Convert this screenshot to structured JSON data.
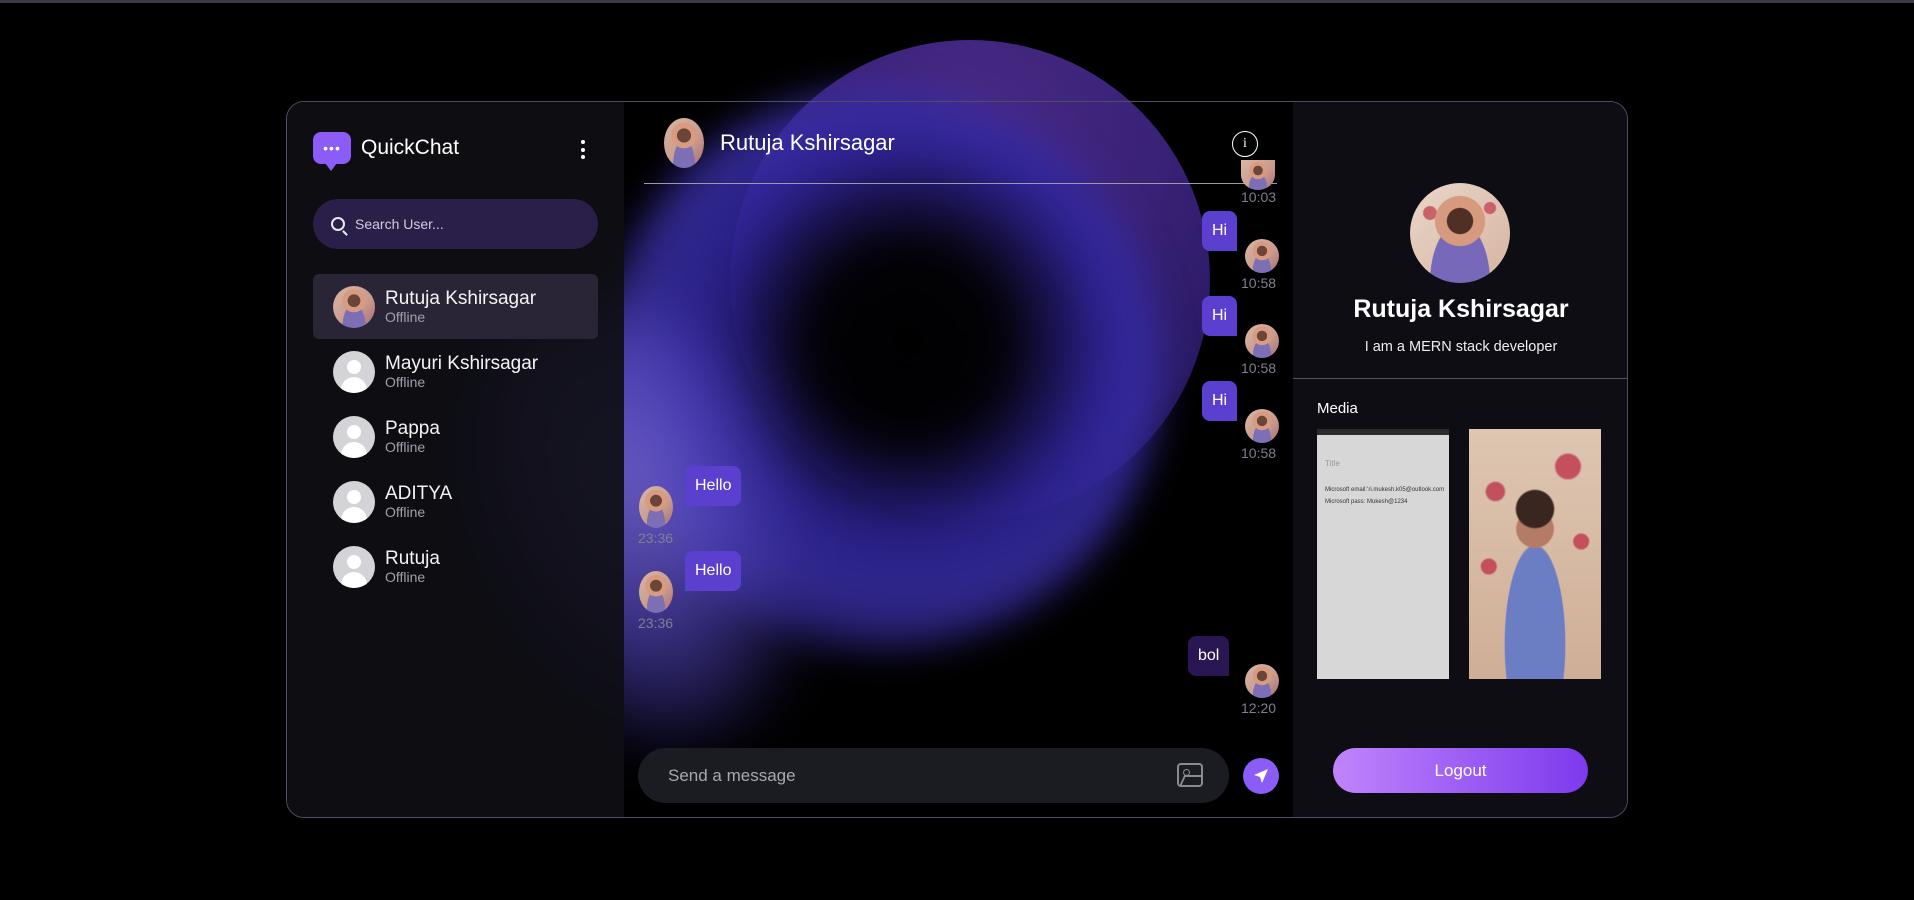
{
  "app": {
    "name": "QuickChat",
    "logo_glyph": "•••"
  },
  "search": {
    "placeholder": "Search User..."
  },
  "users": [
    {
      "name": "Rutuja Kshirsagar",
      "status": "Offline",
      "active": true,
      "avatar": "photo"
    },
    {
      "name": "Mayuri Kshirsagar",
      "status": "Offline",
      "active": false,
      "avatar": "default"
    },
    {
      "name": "Pappa",
      "status": "Offline",
      "active": false,
      "avatar": "default"
    },
    {
      "name": "ADITYA",
      "status": "Offline",
      "active": false,
      "avatar": "default"
    },
    {
      "name": "Rutuja",
      "status": "Offline",
      "active": false,
      "avatar": "default"
    }
  ],
  "chat": {
    "title": "Rutuja Kshirsagar",
    "info_glyph": "i",
    "messages": [
      {
        "text": "",
        "time": "10:03",
        "direction": "out"
      },
      {
        "text": "Hi",
        "time": "10:58",
        "direction": "out"
      },
      {
        "text": "Hi",
        "time": "10:58",
        "direction": "out"
      },
      {
        "text": "Hi",
        "time": "10:58",
        "direction": "out"
      },
      {
        "text": "Hello",
        "time": "23:36",
        "direction": "in"
      },
      {
        "text": "Hello",
        "time": "23:36",
        "direction": "in"
      },
      {
        "text": "bol",
        "time": "12:20",
        "direction": "out"
      }
    ],
    "composer_placeholder": "Send a message"
  },
  "profile": {
    "name": "Rutuja Kshirsagar",
    "bio": "I am a MERN stack developer",
    "media_label": "Media",
    "media_note_lines": [
      "Title",
      "Microsoft email:’ri.mukesh.k05@outlook.com",
      "Microsoft pass: Mukesh@1234"
    ],
    "logout_label": "Logout"
  },
  "colors": {
    "accent": "#8b5cf6",
    "bubble": "#5b3fcf",
    "bubble_dark": "#2a1653",
    "logout_gradient_start": "#c084fc",
    "logout_gradient_end": "#7c3aed"
  }
}
